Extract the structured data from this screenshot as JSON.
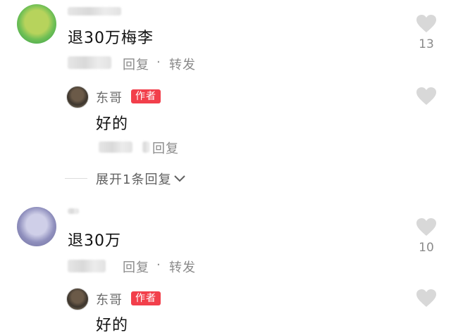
{
  "comments": [
    {
      "text": "退30万梅李",
      "like_count": "13",
      "actions": {
        "reply": "回复",
        "separator": "·",
        "forward": "转发"
      },
      "reply": {
        "author": "东哥",
        "badge": "作者",
        "text": "好的",
        "reply_action": "回复"
      },
      "expand_label": "展开1条回复"
    },
    {
      "text": "退30万",
      "like_count": "10",
      "actions": {
        "reply": "回复",
        "separator": "·",
        "forward": "转发"
      },
      "reply": {
        "author": "东哥",
        "badge": "作者",
        "text": "好的"
      }
    }
  ],
  "icons": {
    "like": "heart-icon",
    "expand": "chevron-down-icon"
  },
  "colors": {
    "badge": "#f23f4b",
    "heart": "#d8d8d8",
    "secondary_text": "#8a8a8a"
  }
}
